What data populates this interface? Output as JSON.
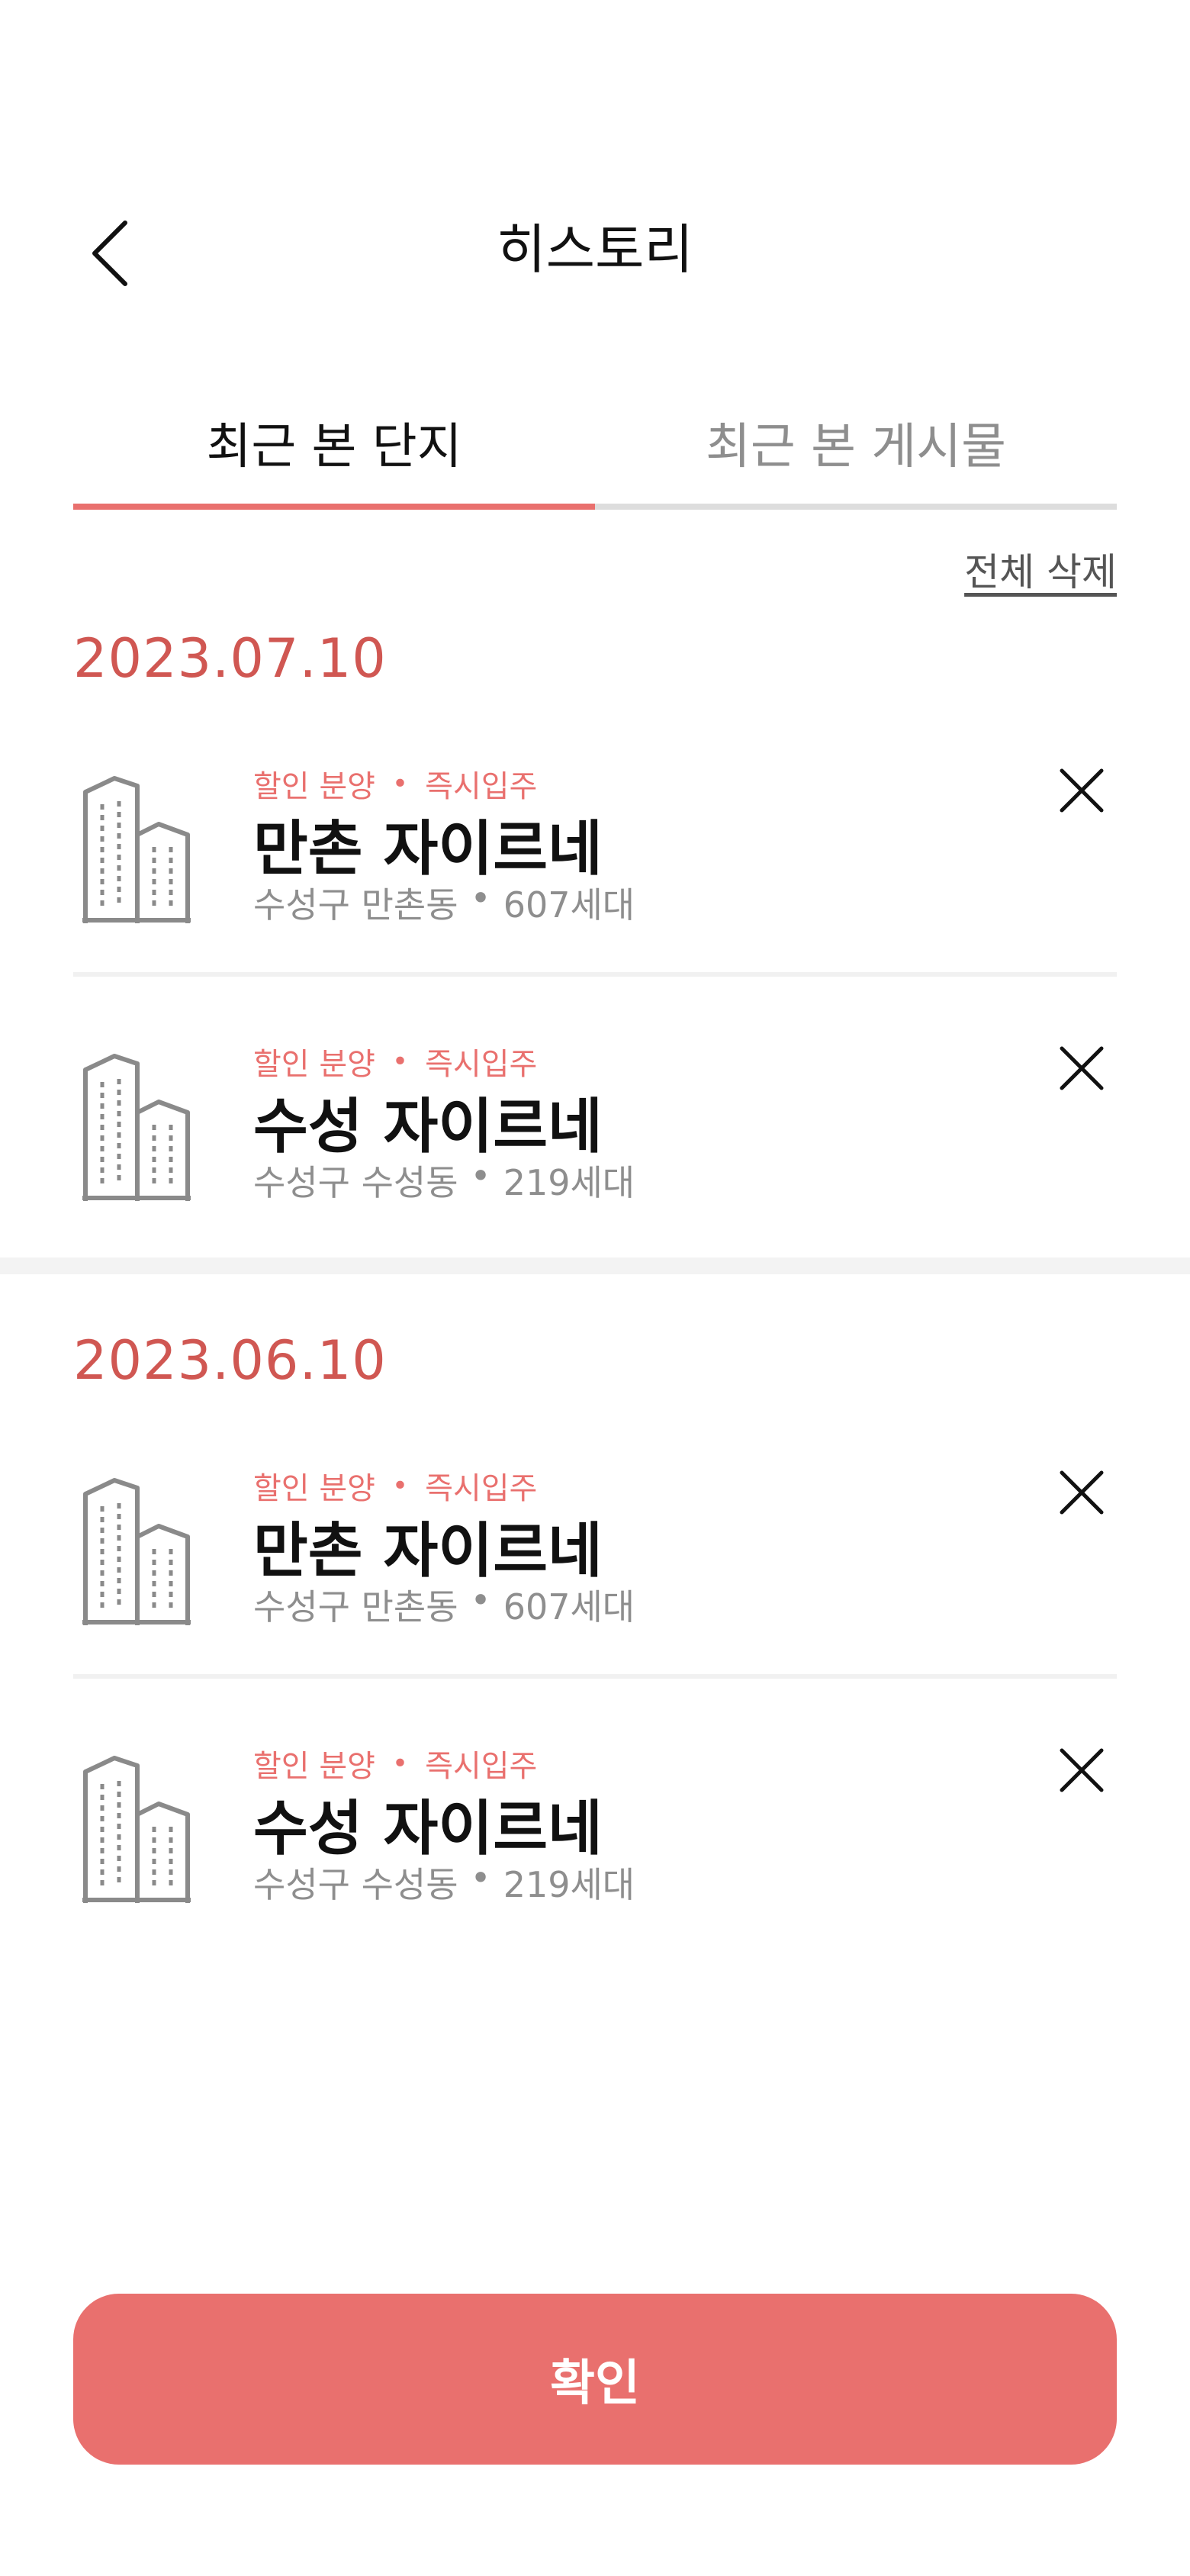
{
  "header": {
    "title": "히스토리"
  },
  "tabs": [
    {
      "label": "최근 본 단지",
      "active": true
    },
    {
      "label": "최근 본 게시물",
      "active": false
    }
  ],
  "delete_all_label": "전체 삭제",
  "sections": [
    {
      "date": "2023.07.10",
      "items": [
        {
          "tag1": "할인 분양",
          "tag_sep": "•",
          "tag2": "즉시입주",
          "name": "만촌 자이르네",
          "location": "수성구 만촌동",
          "meta_sep": "•",
          "households": "607세대"
        },
        {
          "tag1": "할인 분양",
          "tag_sep": "•",
          "tag2": "즉시입주",
          "name": "수성 자이르네",
          "location": "수성구 수성동",
          "meta_sep": "•",
          "households": "219세대"
        }
      ]
    },
    {
      "date": "2023.06.10",
      "items": [
        {
          "tag1": "할인 분양",
          "tag_sep": "•",
          "tag2": "즉시입주",
          "name": "만촌 자이르네",
          "location": "수성구 만촌동",
          "meta_sep": "•",
          "households": "607세대"
        },
        {
          "tag1": "할인 분양",
          "tag_sep": "•",
          "tag2": "즉시입주",
          "name": "수성 자이르네",
          "location": "수성구 수성동",
          "meta_sep": "•",
          "households": "219세대"
        }
      ]
    }
  ],
  "confirm_label": "확인",
  "colors": {
    "accent": "#e9706e",
    "date": "#d05752",
    "muted": "#8e8e8e"
  },
  "icons": {
    "back": "chevron-left-icon",
    "close": "close-icon",
    "building": "building-icon"
  }
}
